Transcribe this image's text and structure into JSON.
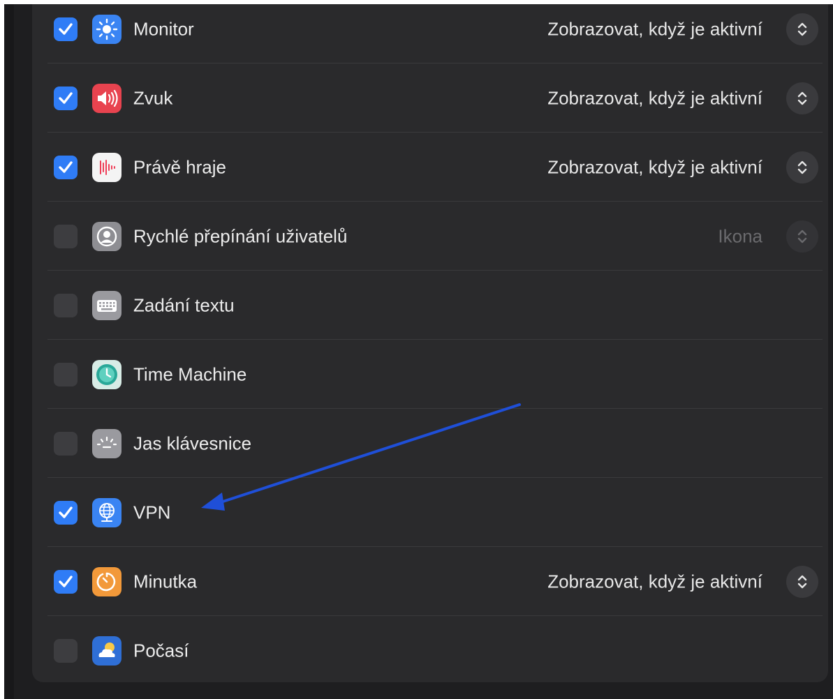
{
  "rows": [
    {
      "label": "Monitor",
      "checked": true,
      "icon": "display-brightness-icon",
      "value": "Zobrazovat, když je aktivní",
      "has_stepper": true,
      "dim": false
    },
    {
      "label": "Zvuk",
      "checked": true,
      "icon": "speaker-icon",
      "value": "Zobrazovat, když je aktivní",
      "has_stepper": true,
      "dim": false
    },
    {
      "label": "Právě hraje",
      "checked": true,
      "icon": "now-playing-icon",
      "value": "Zobrazovat, když je aktivní",
      "has_stepper": true,
      "dim": false
    },
    {
      "label": "Rychlé přepínání uživatelů",
      "checked": false,
      "icon": "user-icon",
      "value": "Ikona",
      "has_stepper": true,
      "dim": true
    },
    {
      "label": "Zadání textu",
      "checked": false,
      "icon": "keyboard-icon",
      "value": "",
      "has_stepper": false,
      "dim": false
    },
    {
      "label": "Time Machine",
      "checked": false,
      "icon": "time-machine-icon",
      "value": "",
      "has_stepper": false,
      "dim": false
    },
    {
      "label": "Jas klávesnice",
      "checked": false,
      "icon": "keyboard-brightness-icon",
      "value": "",
      "has_stepper": false,
      "dim": false
    },
    {
      "label": "VPN",
      "checked": true,
      "icon": "vpn-globe-icon",
      "value": "",
      "has_stepper": false,
      "dim": false
    },
    {
      "label": "Minutka",
      "checked": true,
      "icon": "timer-icon",
      "value": "Zobrazovat, když je aktivní",
      "has_stepper": true,
      "dim": false
    },
    {
      "label": "Počasí",
      "checked": false,
      "icon": "weather-icon",
      "value": "",
      "has_stepper": false,
      "dim": false
    }
  ],
  "colors": {
    "checkbox_on": "#2f7cf6",
    "annotation_arrow": "#1f4fd8"
  }
}
